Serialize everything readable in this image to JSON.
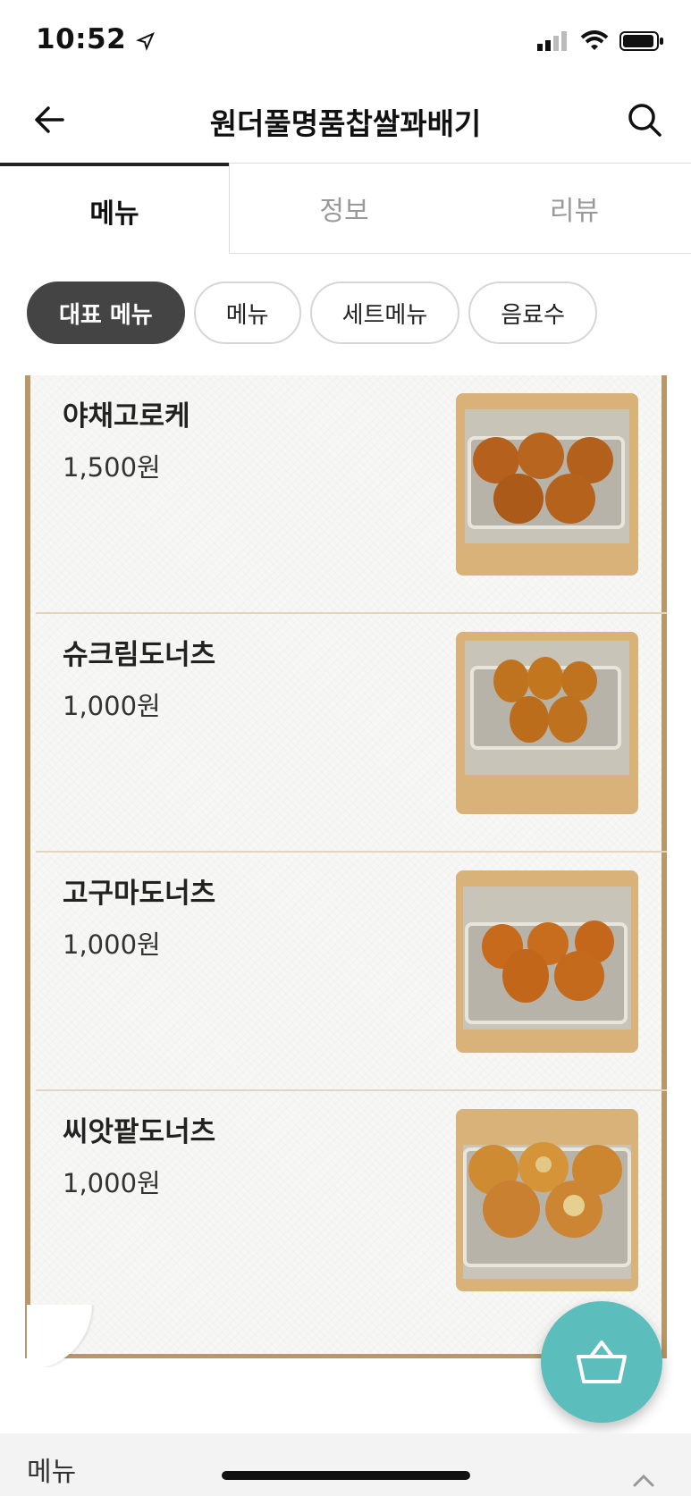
{
  "status_bar": {
    "time": "10:52"
  },
  "header": {
    "title": "원더풀명품찹쌀꽈배기"
  },
  "tabs": [
    {
      "label": "메뉴",
      "active": true
    },
    {
      "label": "정보",
      "active": false
    },
    {
      "label": "리뷰",
      "active": false
    }
  ],
  "chips": [
    {
      "label": "대표 메뉴",
      "active": true
    },
    {
      "label": "메뉴",
      "active": false
    },
    {
      "label": "세트메뉴",
      "active": false
    },
    {
      "label": "음료수",
      "active": false
    }
  ],
  "menu_items": [
    {
      "name": "야채고로케",
      "price": "1,500원"
    },
    {
      "name": "슈크림도너츠",
      "price": "1,000원"
    },
    {
      "name": "고구마도너츠",
      "price": "1,000원"
    },
    {
      "name": "씨앗팥도너츠",
      "price": "1,000원"
    }
  ],
  "bottom_bar": {
    "label": "메뉴"
  },
  "colors": {
    "accent": "#5bbdbc",
    "frame": "#b99868",
    "chip_active": "#444444"
  }
}
